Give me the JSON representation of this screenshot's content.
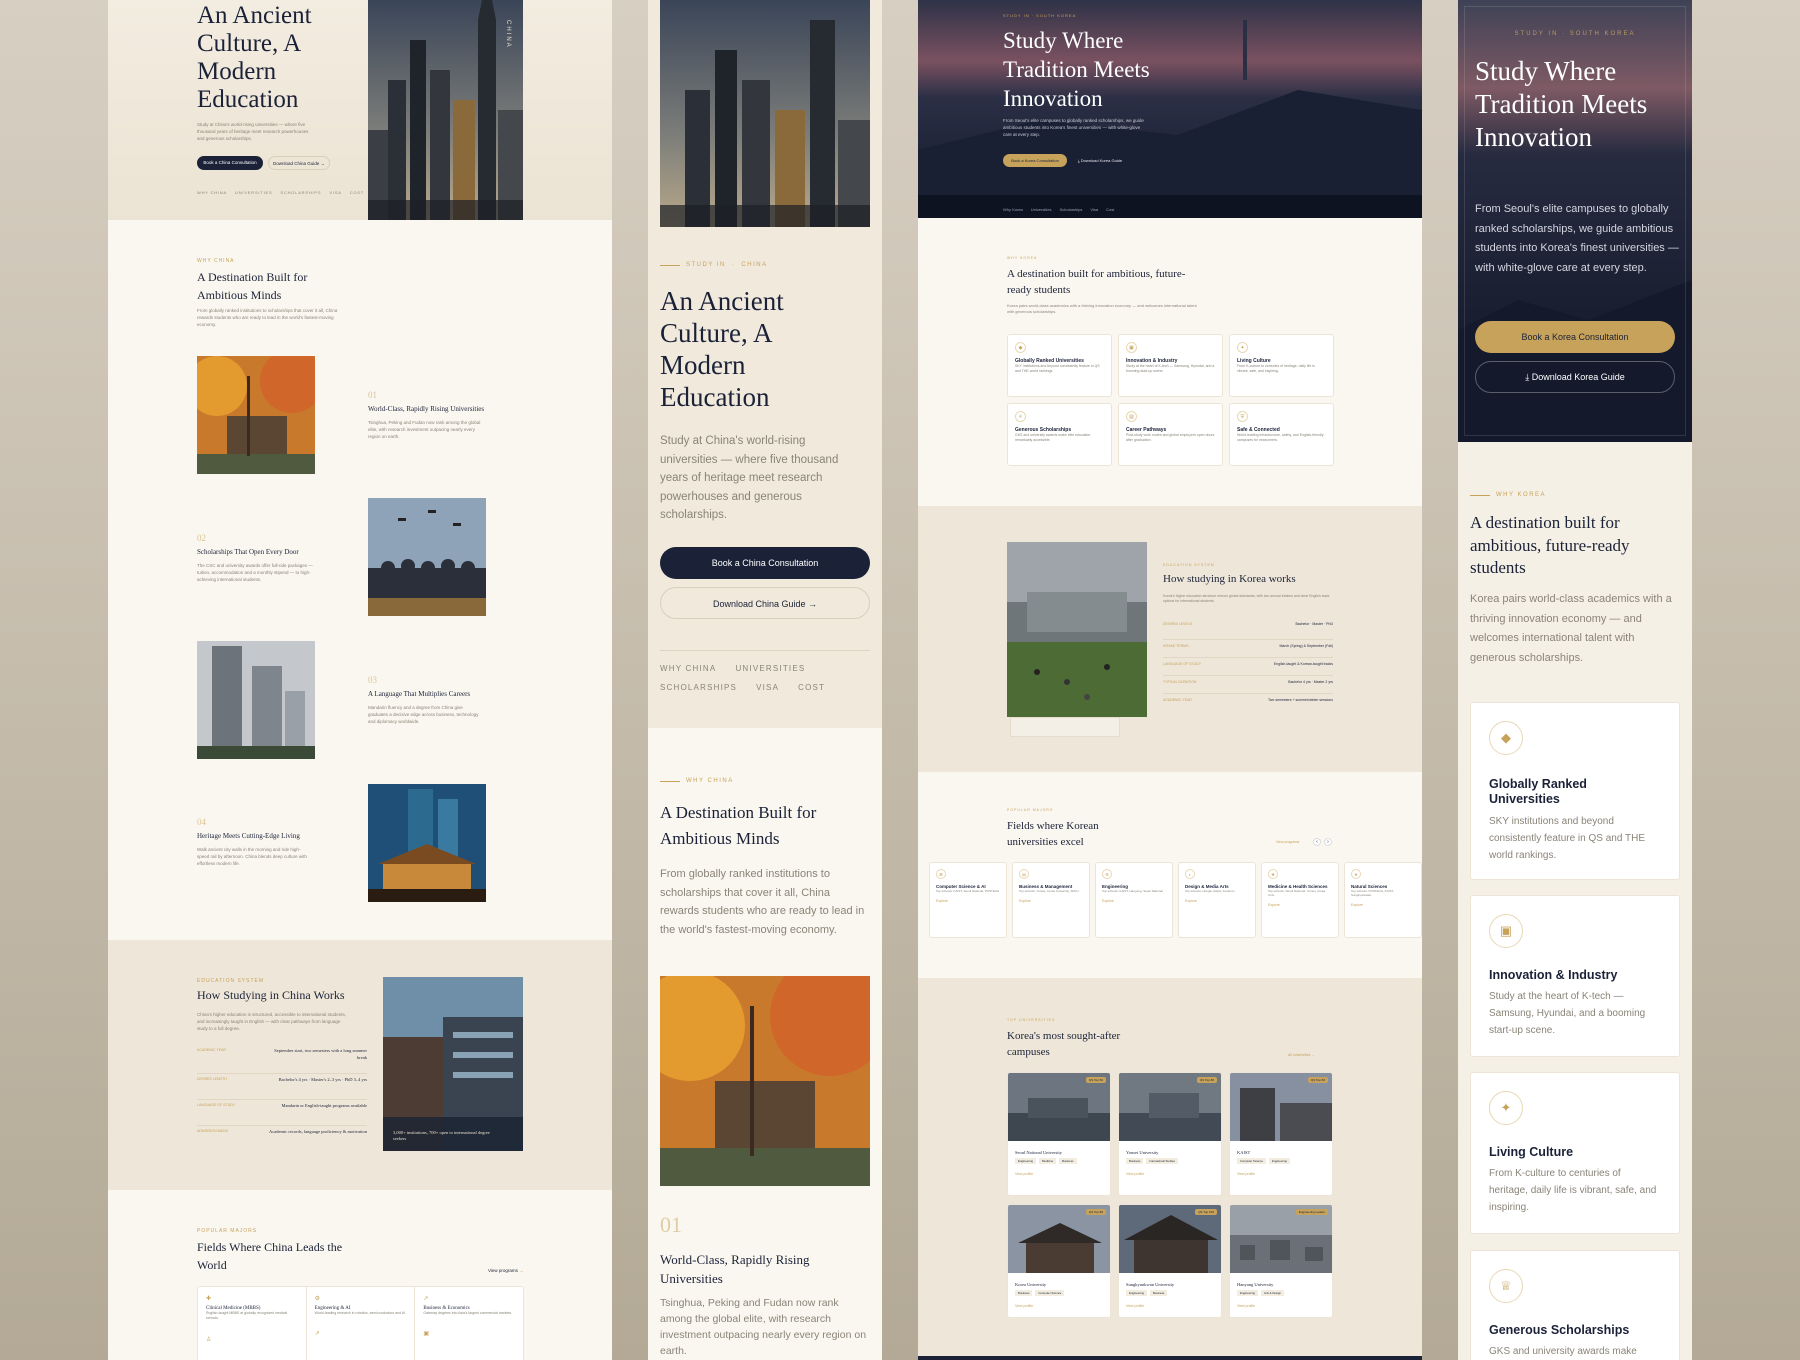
{
  "china": {
    "hero_title": "An Ancient Culture, A Modern Education",
    "hero_desc": "Study at China's world-rising universities — where five thousand years of heritage meet research powerhouses and generous scholarships.",
    "btn_consult": "Book a China Consultation",
    "btn_guide": "Download China Guide",
    "nav": [
      "WHY CHINA",
      "UNIVERSITIES",
      "SCHOLARSHIPS",
      "VISA",
      "COST"
    ],
    "vertical_badge": "CHINA",
    "eyebrow_study": "STUDY IN",
    "eyebrow_country": "CHINA",
    "why_eyebrow": "WHY CHINA",
    "why_title": "A Destination Built for Ambitious Minds",
    "why_desc": "From globally ranked institutions to scholarships that cover it all, China rewards students who are ready to lead in the world's fastest-moving economy.",
    "features": [
      {
        "num": "01",
        "title": "World-Class, Rapidly Rising Universities",
        "desc": "Tsinghua, Peking and Fudan now rank among the global elite, with research investment outpacing nearly every region on earth."
      },
      {
        "num": "02",
        "title": "Scholarships That Open Every Door",
        "desc": "The CSC and university awards offer full-ride packages — tuition, accommodation and a monthly stipend — to high-achieving international students."
      },
      {
        "num": "03",
        "title": "A Language That Multiplies Careers",
        "desc": "Mandarin fluency and a degree from China give graduates a decisive edge across business, technology and diplomacy worldwide."
      },
      {
        "num": "04",
        "title": "Heritage Meets Cutting-Edge Living",
        "desc": "Walk ancient city walls in the morning and ride high-speed rail by afternoon. China blends deep culture with effortless modern life."
      }
    ],
    "how_eyebrow": "EDUCATION SYSTEM",
    "how_title": "How Studying in China Works",
    "how_desc": "China's higher education is structured, accessible to international students, and increasingly taught in English — with clear pathways from language study to a full degree.",
    "how_rows": [
      {
        "label": "ACADEMIC YEAR",
        "value": "September start, two semesters with a long summer break"
      },
      {
        "label": "DEGREE LENGTH",
        "value": "Bachelor's 4 yrs · Master's 2–3 yrs · PhD 3–4 yrs"
      },
      {
        "label": "LANGUAGE OF STUDY",
        "value": "Mandarin or English-taught programs available"
      },
      {
        "label": "ADMISSION BASIS",
        "value": "Academic records, language proficiency & motivation"
      }
    ],
    "how_caption": "3,000+ institutions, 700+ open to international degree seekers",
    "fields_eyebrow": "POPULAR MAJORS",
    "fields_title": "Fields Where China Leads the World",
    "fields_link": "View programs",
    "fields": [
      {
        "title": "Clinical Medicine (MBBS)",
        "desc": "English-taught MBBS at globally recognized medical schools."
      },
      {
        "title": "Engineering & AI",
        "desc": "World-leading research in robotics, semiconductors and AI."
      },
      {
        "title": "Business & Economics",
        "desc": "Gateway degrees into Asia's largest commercial markets."
      }
    ]
  },
  "korea": {
    "eyebrow": "STUDY IN · SOUTH KOREA",
    "hero_title": "Study Where Tradition Meets Innovation",
    "hero_desc": "From Seoul's elite campuses to globally ranked scholarships, we guide ambitious students into Korea's finest universities — with white-glove care at every step.",
    "btn_consult": "Book a Korea Consultation",
    "btn_guide": "Download Korea Guide",
    "nav": [
      "Why Korea",
      "Universities",
      "Scholarships",
      "Visa",
      "Cost"
    ],
    "why_eyebrow": "WHY KOREA",
    "why_title": "A destination built for ambitious, future-ready students",
    "why_desc": "Korea pairs world-class academics with a thriving innovation economy — and welcomes international talent with generous scholarships.",
    "features": [
      {
        "icon": "graduation-cap-icon",
        "title": "Globally Ranked Universities",
        "desc": "SKY institutions and beyond consistently feature in QS and THE world rankings."
      },
      {
        "icon": "chip-icon",
        "title": "Innovation & Industry",
        "desc": "Study at the heart of K-tech — Samsung, Hyundai, and a booming start-up scene."
      },
      {
        "icon": "sparkle-icon",
        "title": "Living Culture",
        "desc": "From K-culture to centuries of heritage, daily life is vibrant, safe, and inspiring."
      },
      {
        "icon": "award-icon",
        "title": "Generous Scholarships",
        "desc": "GKS and university awards make elite education remarkably accessible."
      },
      {
        "icon": "briefcase-icon",
        "title": "Career Pathways",
        "desc": "Post-study work routes and global employers open doors after graduation."
      },
      {
        "icon": "shield-icon",
        "title": "Safe & Connected",
        "desc": "World-leading infrastructure, safety, and English-friendly campuses for newcomers."
      }
    ],
    "how_eyebrow": "EDUCATION SYSTEM",
    "how_title": "How studying in Korea works",
    "how_desc": "Korea's higher education structure mirrors global standards, with two annual intakes and clear English-track options for international students.",
    "how_rows": [
      {
        "label": "DEGREE LEVELS",
        "value": "Bachelor · Master · PhD"
      },
      {
        "label": "INTAKE TERMS",
        "value": "March (Spring) & September (Fall)"
      },
      {
        "label": "LANGUAGE OF STUDY",
        "value": "English-taught & Korean-taught tracks"
      },
      {
        "label": "TYPICAL DURATION",
        "value": "Bachelor 4 yrs · Master 2 yrs"
      },
      {
        "label": "ACADEMIC YEAR",
        "value": "Two semesters + summer/winter sessions"
      }
    ],
    "fields_eyebrow": "POPULAR MAJORS",
    "fields_title": "Fields where Korean universities excel",
    "fields_link": "View programs",
    "fields": [
      {
        "title": "Computer Science & AI",
        "desc": "Top schools: KAIST, Seoul National, POSTECH",
        "cta": "Explore"
      },
      {
        "title": "Business & Management",
        "desc": "Top schools: Yonsei, Korea University, SKKU",
        "cta": "Explore"
      },
      {
        "title": "Engineering",
        "desc": "Top schools: KAIST, Hanyang, Seoul National",
        "cta": "Explore"
      },
      {
        "title": "Design & Media Arts",
        "desc": "Top schools: Hongik, Ewha, Kookmin",
        "cta": "Explore"
      },
      {
        "title": "Medicine & Health Sciences",
        "desc": "Top schools: Seoul National, Yonsei, Korea Univ.",
        "cta": "Explore"
      },
      {
        "title": "Natural Sciences",
        "desc": "Top schools: POSTECH, KAIST, Sungkyunkwan",
        "cta": "Explore"
      }
    ],
    "unis_eyebrow": "TOP UNIVERSITIES",
    "unis_title": "Korea's most sought-after campuses",
    "unis_link": "All universities",
    "unis": [
      {
        "name": "Seoul National University",
        "badge": "QS Top 50",
        "tags": [
          "Engineering",
          "Medicine",
          "Business"
        ],
        "cta": "View profile"
      },
      {
        "name": "Yonsei University",
        "badge": "QS Top 80",
        "tags": [
          "Business",
          "International Studies"
        ],
        "cta": "View profile"
      },
      {
        "name": "KAIST",
        "badge": "QS Top 60",
        "tags": [
          "Computer Science",
          "Engineering"
        ],
        "cta": "View profile"
      },
      {
        "name": "Korea University",
        "badge": "QS Top 80",
        "tags": [
          "Business",
          "Computer Science"
        ],
        "cta": "View profile"
      },
      {
        "name": "Sungkyunkwan University",
        "badge": "QS Top 150",
        "tags": [
          "Engineering",
          "Business"
        ],
        "cta": "View profile"
      },
      {
        "name": "Hanyang University",
        "badge": "Engineering Leader",
        "tags": [
          "Engineering",
          "Arts & Design"
        ],
        "cta": "View profile"
      }
    ]
  },
  "korea_mobile": {
    "eyebrow_study": "STUDY IN",
    "eyebrow_country": "SOUTH KOREA",
    "hero_title": "Study Where Tradition Meets Innovation",
    "hero_desc": "From Seoul's elite campuses to globally ranked scholarships, we guide ambitious students into Korea's finest universities — with white-glove care at every step.",
    "btn_consult": "Book a Korea Consultation",
    "btn_guide": "Download Korea Guide",
    "why_eyebrow": "WHY KOREA",
    "why_title": "A destination built for ambitious, future-ready students",
    "why_desc": "Korea pairs world-class academics with a thriving innovation economy — and welcomes international talent with generous scholarships.",
    "features": [
      {
        "icon": "graduation-cap-icon",
        "title": "Globally Ranked Universities",
        "desc": "SKY institutions and beyond consistently feature in QS and THE world rankings."
      },
      {
        "icon": "chip-icon",
        "title": "Innovation & Industry",
        "desc": "Study at the heart of K-tech — Samsung, Hyundai, and a booming start-up scene."
      },
      {
        "icon": "sparkle-icon",
        "title": "Living Culture",
        "desc": "From K-culture to centuries of heritage, daily life is vibrant, safe, and inspiring."
      },
      {
        "icon": "award-icon",
        "title": "Generous Scholarships",
        "desc": "GKS and university awards make"
      }
    ]
  }
}
